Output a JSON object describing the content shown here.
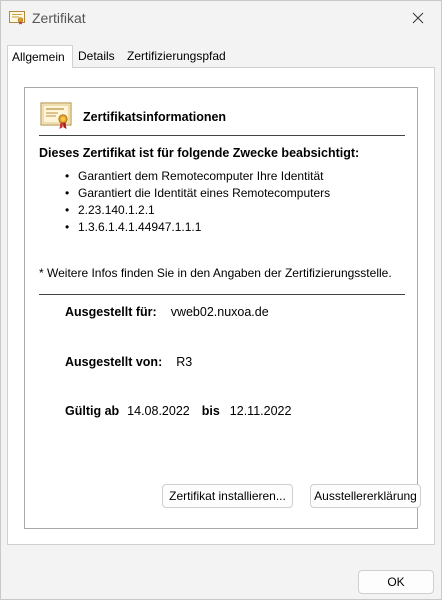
{
  "window": {
    "title": "Zertifikat"
  },
  "tabs": [
    {
      "label": "Allgemein",
      "active": true
    },
    {
      "label": "Details",
      "active": false
    },
    {
      "label": "Zertifizierungspfad",
      "active": false
    }
  ],
  "certificate": {
    "heading": "Zertifikatsinformationen",
    "purpose_heading": "Dieses Zertifikat ist für folgende Zwecke beabsichtigt:",
    "purposes": [
      "Garantiert dem Remotecomputer Ihre Identität",
      "Garantiert die Identität eines Remotecomputers",
      "2.23.140.1.2.1",
      "1.3.6.1.4.1.44947.1.1.1"
    ],
    "note": "* Weitere Infos finden Sie in den Angaben der Zertifizierungsstelle.",
    "issued_to_label": "Ausgestellt für:",
    "issued_to_value": "vweb02.nuxoa.de",
    "issued_by_label": "Ausgestellt von:",
    "issued_by_value": "R3",
    "valid_from_label": "Gültig ab",
    "valid_from_value": "14.08.2022",
    "valid_to_label": "bis",
    "valid_to_value": "12.11.2022"
  },
  "buttons": {
    "install": "Zertifikat installieren...",
    "issuer_statement": "Ausstellererklärung",
    "ok": "OK"
  },
  "icons": {
    "title": "certificate-icon",
    "close": "close-icon",
    "cert": "certificate-icon"
  },
  "colors": {
    "window_bg": "#f3f3f3",
    "panel_bg": "#ffffff",
    "border": "#d0d0d0"
  }
}
